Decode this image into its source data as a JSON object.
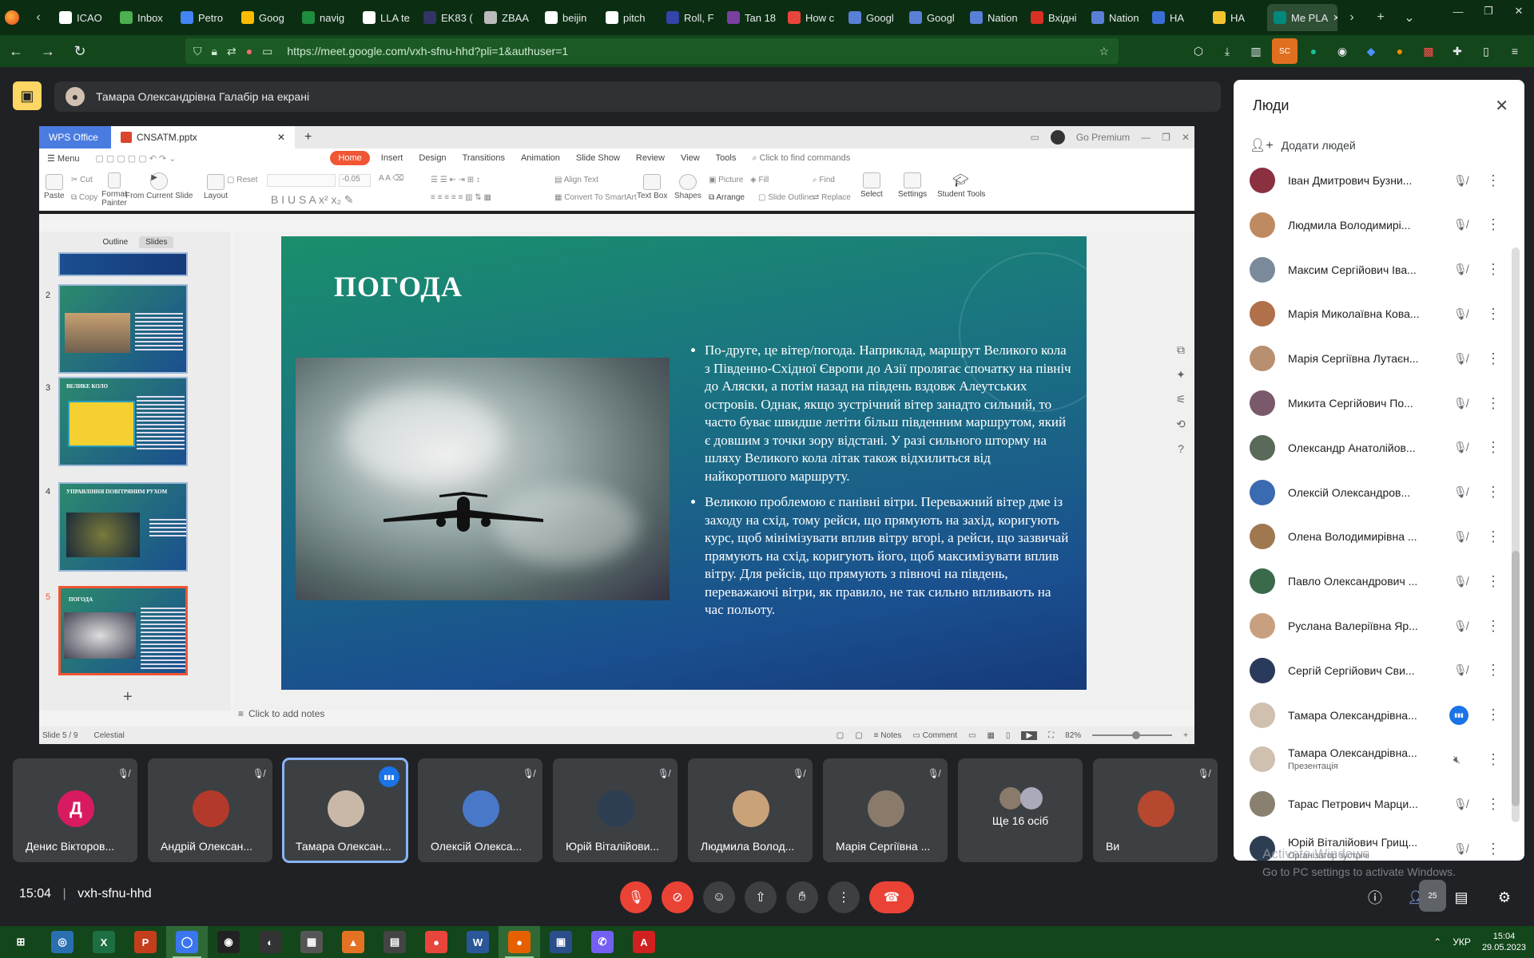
{
  "browser": {
    "tabs": [
      {
        "label": "ICAO",
        "color": "#ffffff"
      },
      {
        "label": "Inbox",
        "color": "#4caf50"
      },
      {
        "label": "Petro",
        "color": "#4285f4"
      },
      {
        "label": "Goog",
        "color": "#fbbc04"
      },
      {
        "label": "navig",
        "color": "#1e8e3e"
      },
      {
        "label": "LLA te",
        "color": "#ffffff"
      },
      {
        "label": "EK83 (",
        "color": "#333366"
      },
      {
        "label": "ZBAA",
        "color": "#bbbbbb"
      },
      {
        "label": "beijin",
        "color": "#ffffff"
      },
      {
        "label": "pitch",
        "color": "#ffffff"
      },
      {
        "label": "Roll, F",
        "color": "#3344aa"
      },
      {
        "label": "Tan 18",
        "color": "#7b3fa0"
      },
      {
        "label": "How c",
        "color": "#e8453c"
      },
      {
        "label": "Googl",
        "color": "#5a7fd6"
      },
      {
        "label": "Googl",
        "color": "#5a7fd6"
      },
      {
        "label": "Nation",
        "color": "#5a7fd6"
      },
      {
        "label": "Вхідні",
        "color": "#d93025"
      },
      {
        "label": "Nation",
        "color": "#5a7fd6"
      },
      {
        "label": "НА",
        "color": "#3b6fd6"
      },
      {
        "label": "НА",
        "color": "#f4c430"
      },
      {
        "label": "Me PLA",
        "color": "#00897b",
        "active": true
      }
    ],
    "url": "https://meet.google.com/vxh-sfnu-hhd?pli=1&authuser=1"
  },
  "presenter_banner": {
    "text": "Тамара Олександрівна Галабір на екрані"
  },
  "wps": {
    "app_tab": "WPS Office",
    "doc_tab": "CNSATM.pptx",
    "premium": "Go Premium",
    "menu_btn": "Menu",
    "menu": [
      "Home",
      "Insert",
      "Design",
      "Transitions",
      "Animation",
      "Slide Show",
      "Review",
      "View",
      "Tools"
    ],
    "search_placeholder": "Click to find commands",
    "ribbon": {
      "paste": "Paste",
      "cut": "Cut",
      "copy": "Copy",
      "format_painter": "Format Painter",
      "from_current": "From Current Slide",
      "layout": "Layout",
      "reset": "Reset",
      "font_size": "-0.05",
      "align_text": "Align Text",
      "convert": "Convert To SmartArt",
      "text_box": "Text Box",
      "shapes": "Shapes",
      "picture": "Picture",
      "fill": "Fill",
      "arrange": "Arrange",
      "slide_outline": "Slide Outline",
      "find": "Find",
      "replace": "Replace",
      "select": "Select",
      "settings": "Settings",
      "student_tools": "Student Tools"
    },
    "pane_tabs": [
      "Outline",
      "Slides"
    ],
    "thumbnails": [
      {
        "num": "2",
        "title": ""
      },
      {
        "num": "3",
        "title": "ВЕЛИКЕ КОЛО"
      },
      {
        "num": "4",
        "title": "УПРАВЛІННЯ ПОВІТРЯНИМ РУХОМ"
      },
      {
        "num": "5",
        "title": "ПОГОДА"
      }
    ],
    "slide": {
      "title": "ПОГОДА",
      "bullets": [
        "По-друге, це вітер/погода. Наприклад, маршрут Великого кола з Південно-Східної Європи до Азії пролягає спочатку на північ до Аляски, а потім назад на південь вздовж Алеутських островів. Однак, якщо зустрічний вітер занадто сильний, то часто буває швидше летіти більш південним маршрутом, який є довшим з точки зору відстані. У разі сильного шторму на шляху Великого кола літак також відхилиться від найкоротшого маршруту.",
        "Великою проблемою є панівні вітри. Переважний вітер дме із заходу на схід, тому рейси, що прямують на захід, коригують курс, щоб мінімізувати вплив вітру вгорі, а рейси, що зазвичай прямують на схід, коригують його, щоб максимізувати вплив вітру. Для рейсів, що прямують з півночі на південь, переважаючі вітри, як правило, не так сильно впливають на час польоту."
      ]
    },
    "notes_placeholder": "Click to add notes",
    "status": {
      "slide": "Slide 5 / 9",
      "theme": "Celestial",
      "notes": "Notes",
      "comment": "Comment",
      "zoom": "82%"
    }
  },
  "tiles": [
    {
      "name": "Денис Вікторов...",
      "initial": "Д",
      "color": "#d81b60",
      "state": "muted"
    },
    {
      "name": "Андрій Олексан...",
      "color": "#b33a2a",
      "state": "muted"
    },
    {
      "name": "Тамара Олексан...",
      "color": "#c9b8a8",
      "state": "speaking"
    },
    {
      "name": "Олексій Олекса...",
      "color": "#4a78c8",
      "state": "muted"
    },
    {
      "name": "Юрій Віталійови...",
      "color": "#2d3e52",
      "state": "muted"
    },
    {
      "name": "Людмила Волод...",
      "color": "#c9a27a",
      "state": "muted"
    },
    {
      "name": "Марія Сергіївна ...",
      "color": "#8a7a6a",
      "state": "muted"
    },
    {
      "name": "",
      "more": "Ще 16 осіб",
      "color": "#777777",
      "state": "none"
    },
    {
      "name": "Ви",
      "color": "#b5482e",
      "state": "muted"
    }
  ],
  "meeting": {
    "time": "15:04",
    "code": "vxh-sfnu-hhd",
    "people_badge": "25"
  },
  "people_panel": {
    "title": "Люди",
    "add_people": "Додати людей",
    "participants": [
      {
        "name": "Іван Дмитрович Бузни...",
        "sub": "",
        "color": "#8a3040",
        "mic": "muted"
      },
      {
        "name": "Людмила Володимирі...",
        "sub": "",
        "color": "#c08a60",
        "mic": "muted"
      },
      {
        "name": "Максим Сергійович Іва...",
        "sub": "",
        "color": "#7a8a9a",
        "mic": "muted"
      },
      {
        "name": "Марія Миколаївна Кова...",
        "sub": "",
        "color": "#b0704a",
        "mic": "muted"
      },
      {
        "name": "Марія Сергіївна Лутаєн...",
        "sub": "",
        "color": "#b89070",
        "mic": "muted"
      },
      {
        "name": "Микита Сергійович По...",
        "sub": "",
        "color": "#7a5a6a",
        "mic": "muted"
      },
      {
        "name": "Олександр Анатолійов...",
        "sub": "",
        "color": "#5a6a5a",
        "mic": "muted"
      },
      {
        "name": "Олексій Олександров...",
        "sub": "",
        "color": "#3a6ab0",
        "mic": "muted"
      },
      {
        "name": "Олена Володимирівна ...",
        "sub": "",
        "color": "#a07850",
        "mic": "muted"
      },
      {
        "name": "Павло Олександрович ...",
        "sub": "",
        "color": "#3a6a4a",
        "mic": "muted"
      },
      {
        "name": "Руслана Валеріївна Яр...",
        "sub": "",
        "color": "#c8a080",
        "mic": "muted"
      },
      {
        "name": "Сергій Сергійович Сви...",
        "sub": "",
        "color": "#2a3a5a",
        "mic": "muted"
      },
      {
        "name": "Тамара Олександрівна...",
        "sub": "",
        "color": "#d0c0b0",
        "mic": "speaking"
      },
      {
        "name": "Тамара Олександрівна...",
        "sub": "Презентація",
        "color": "#d0c0b0",
        "mic": "presenting"
      },
      {
        "name": "Тарас Петрович Марци...",
        "sub": "",
        "color": "#8a8070",
        "mic": "muted"
      },
      {
        "name": "Юрій Віталійович Грищ...",
        "sub": "Організатор зустрічі",
        "color": "#2d3e52",
        "mic": "muted"
      }
    ]
  },
  "windows": {
    "activate_title": "Activate Windows",
    "activate_sub": "Go to PC settings to activate Windows."
  },
  "taskbar": {
    "apps": [
      {
        "name": "start",
        "color": "#14461c",
        "glyph": "⊞"
      },
      {
        "name": "app-blue",
        "color": "#2a6fb0",
        "glyph": "◎"
      },
      {
        "name": "excel",
        "color": "#1d6f42",
        "glyph": "X"
      },
      {
        "name": "powerpoint",
        "color": "#c43e1c",
        "glyph": "P"
      },
      {
        "name": "signal",
        "color": "#3a76f0",
        "glyph": "◯",
        "active": true
      },
      {
        "name": "camera",
        "color": "#222222",
        "glyph": "◉"
      },
      {
        "name": "obs",
        "color": "#333333",
        "glyph": "◐"
      },
      {
        "name": "calculator",
        "color": "#555555",
        "glyph": "▦"
      },
      {
        "name": "matlab",
        "color": "#e37222",
        "glyph": "▲"
      },
      {
        "name": "scanner",
        "color": "#444444",
        "glyph": "▤"
      },
      {
        "name": "chrome",
        "color": "#e8453c",
        "glyph": "●"
      },
      {
        "name": "word",
        "color": "#2b579a",
        "glyph": "W"
      },
      {
        "name": "firefox",
        "color": "#e66000",
        "glyph": "●",
        "active": true
      },
      {
        "name": "save",
        "color": "#2a4e8a",
        "glyph": "▣"
      },
      {
        "name": "viber",
        "color": "#7360f2",
        "glyph": "✆"
      },
      {
        "name": "acrobat",
        "color": "#d02020",
        "glyph": "A"
      }
    ],
    "lang": "УКР",
    "time": "15:04",
    "date": "29.05.2023"
  }
}
